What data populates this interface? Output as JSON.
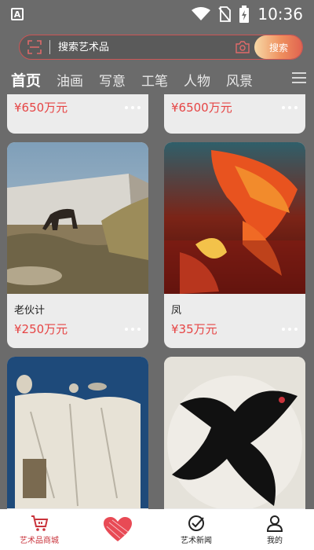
{
  "status": {
    "time": "10:36",
    "app_badge": "A"
  },
  "search": {
    "placeholder": "搜索艺术品",
    "button_label": "搜索"
  },
  "tabs": [
    "首页",
    "油画",
    "写意",
    "工笔",
    "人物",
    "风景"
  ],
  "cards": [
    {
      "title": "",
      "price": "¥650万元"
    },
    {
      "title": "",
      "price": "¥6500万元"
    },
    {
      "title": "老伙计",
      "price": "¥250万元"
    },
    {
      "title": "凤",
      "price": "¥35万元"
    },
    {
      "title": "",
      "price": ""
    },
    {
      "title": "",
      "price": ""
    }
  ],
  "nav": {
    "shop_label": "艺术品商城",
    "news_label": "艺术新闻",
    "mine_label": "我的"
  },
  "colors": {
    "accent": "#c9333b",
    "price": "#e64545"
  }
}
